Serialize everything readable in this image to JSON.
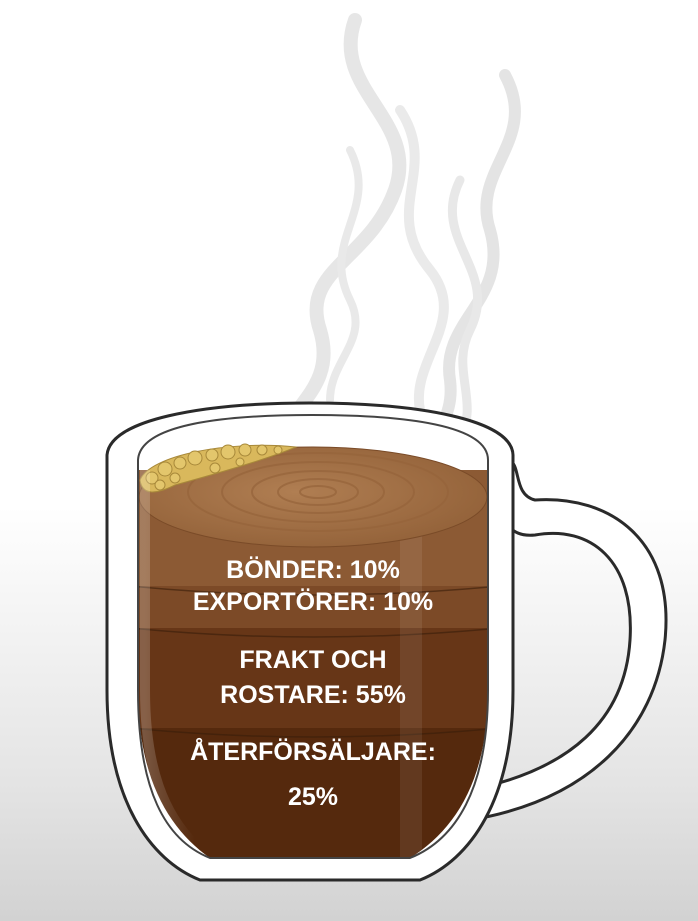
{
  "chart_data": {
    "type": "stacked-cup",
    "unit": "%",
    "segments": [
      {
        "lines": [
          "BÖNDER: 10%"
        ],
        "value": 10,
        "color": "#8c5a34"
      },
      {
        "lines": [
          "EXPORTÖRER: 10%"
        ],
        "value": 10,
        "color": "#7c4a27"
      },
      {
        "lines": [
          "FRAKT OCH",
          "ROSTARE: 55%"
        ],
        "value": 55,
        "color": "#673617"
      },
      {
        "lines": [
          "ÅTERFÖRSÄLJARE:",
          "25%"
        ],
        "value": 25,
        "color": "#55290d"
      }
    ],
    "colors": {
      "coffee_surface": "#a87548",
      "foam": "#d9b85c",
      "cup_outline": "#2a2a2a"
    }
  }
}
